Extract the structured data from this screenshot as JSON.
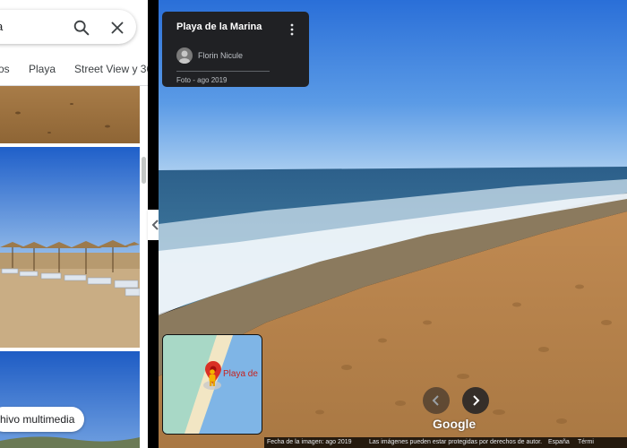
{
  "search": {
    "text": "a"
  },
  "tabs": [
    {
      "label": "os"
    },
    {
      "label": "Playa"
    },
    {
      "label": "Street View y 36"
    }
  ],
  "media_chip": {
    "label": "hivo multimedia"
  },
  "info_card": {
    "title": "Playa de la Marina",
    "author": "Florin Nicule",
    "date": "Foto - ago 2019"
  },
  "minimap": {
    "label": "Playa de"
  },
  "google_logo": "Google",
  "footer": {
    "image_date": "Fecha de la imagen: ago 2019",
    "copyright": "Las imágenes pueden estar protegidas por derechos de autor.",
    "country": "España",
    "terms": "Térmi"
  },
  "icons": {
    "search": "search-icon",
    "close": "close-icon",
    "menu": "more-vert-icon",
    "prev": "chevron-left-icon",
    "next": "chevron-right-icon",
    "collapse": "chevron-left-icon",
    "pin": "map-pin-icon",
    "pegman": "pegman-icon"
  },
  "colors": {
    "sky": "#3a7fe0",
    "sea": "#3d6f9a",
    "sand": "#b8844c",
    "card": "#202124",
    "pin": "#d93025"
  }
}
